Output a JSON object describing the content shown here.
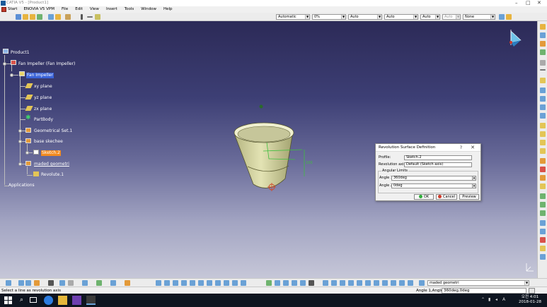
{
  "window": {
    "title": "CATIA V5 - [Product1]"
  },
  "menu": {
    "start": "Start",
    "items": [
      "ENOVIA V5 VPM",
      "File",
      "Edit",
      "View",
      "Insert",
      "Tools",
      "Window",
      "Help"
    ]
  },
  "toolbar": {
    "combos": [
      {
        "value": "Automatic"
      },
      {
        "value": "0%"
      },
      {
        "value": "Auto"
      },
      {
        "value": "Auto"
      },
      {
        "value": "Auto"
      },
      {
        "value": "Auto"
      },
      {
        "value": "None"
      }
    ]
  },
  "tree": {
    "product": "Product1",
    "part_instance": "Fan Impeller (Fan Impeller)",
    "part": "Fan Impeller",
    "xy": "xy plane",
    "yz": "yz plane",
    "zx": "zx plane",
    "partbody": "PartBody",
    "geoset": "Geometrical Set.1",
    "base": "base skechee",
    "sketch": "Sketch.2",
    "maded": "maded geometri",
    "revolute": "Revolute.1",
    "applications": "Applications"
  },
  "dialog": {
    "title": "Revolution Surface Definition",
    "help": "?",
    "close": "✕",
    "profile_label": "Profile:",
    "profile_value": "Sketch.2",
    "axis_label": "Revolution axis:",
    "axis_value": "Default (Sketch axis)",
    "limits_label": "Angular Limits",
    "angle1_label": "Angle 1:",
    "angle1_value": "360deg",
    "angle2_label": "Angle 2:",
    "angle2_value": "0deg",
    "ok": "OK",
    "cancel": "Cancel",
    "preview": "Preview"
  },
  "bottom_toolbar": {
    "set_combo": "maded geometri"
  },
  "status": {
    "message": "Select a line as revolution axis",
    "input_label": "Angle 1,Angle 2",
    "input_value": "360deg,0deg"
  },
  "taskbar": {
    "time": "오전 4:01",
    "date": "2018-01-28"
  },
  "model": {
    "dimension": "100"
  },
  "colors": {
    "selection": "#3a63d8",
    "highlight": "#f28a1f",
    "surface": "#d8d8a6"
  }
}
